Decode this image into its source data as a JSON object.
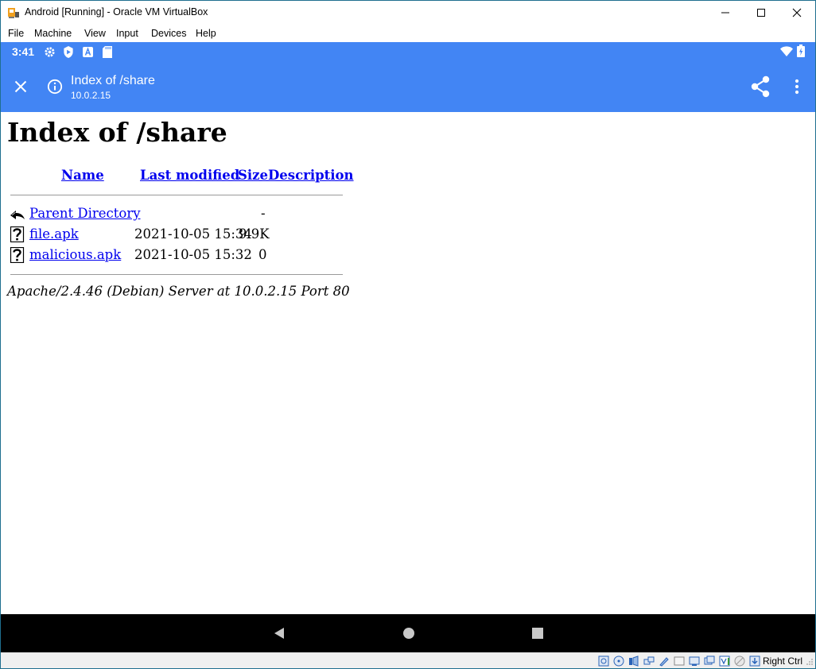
{
  "window": {
    "title": "Android [Running] - Oracle VM VirtualBox"
  },
  "menu": [
    "File",
    "Machine",
    "View",
    "Input",
    "Devices",
    "Help"
  ],
  "android": {
    "time": "3:41",
    "appbar": {
      "title": "Index of /share",
      "subtitle": "10.0.2.15"
    }
  },
  "page": {
    "heading": "Index of /share",
    "columns": {
      "name": "Name",
      "modified": "Last modified",
      "size": "Size",
      "description": "Description"
    },
    "rows": [
      {
        "name": "Parent Directory",
        "modified": "",
        "size": "-",
        "icon": "back-arrow-icon"
      },
      {
        "name": "file.apk",
        "modified": "2021-10-05 15:34",
        "size": "9.9K",
        "icon": "unknown-file-icon"
      },
      {
        "name": "malicious.apk",
        "modified": "2021-10-05 15:32",
        "size": "0",
        "icon": "unknown-file-icon"
      }
    ],
    "footer": "Apache/2.4.46 (Debian) Server at 10.0.2.15 Port 80"
  },
  "vbox_status": {
    "host_key": "Right Ctrl"
  },
  "colors": {
    "accent": "#4285f4",
    "link": "#0000ee"
  }
}
